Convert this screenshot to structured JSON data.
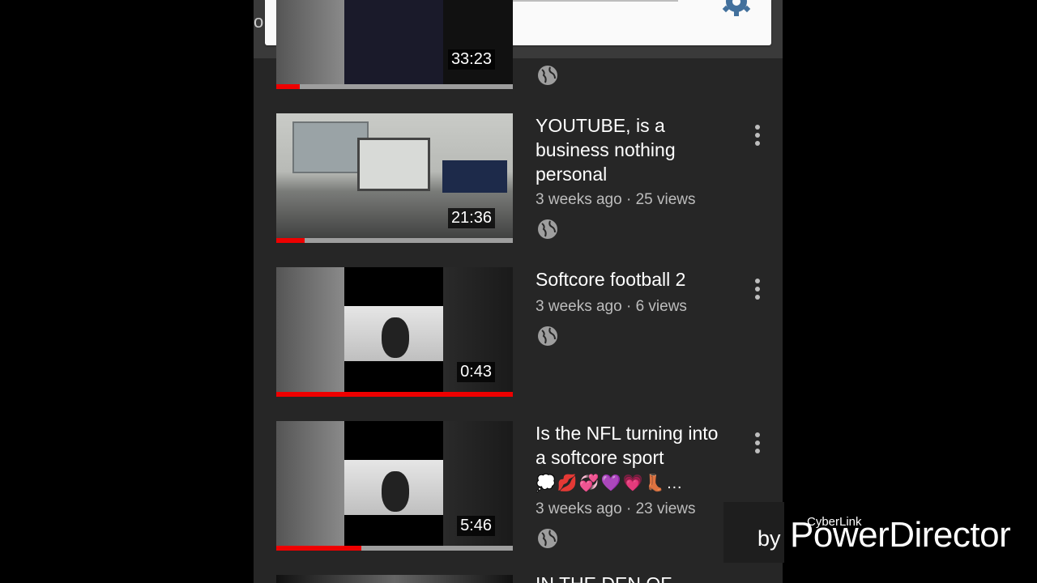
{
  "panel": {
    "edge_letter": "o",
    "music_icon": "music-note-off-icon",
    "settings_icon": "gear-icon"
  },
  "videos": [
    {
      "title": "",
      "duration": "33:23",
      "progress_pct": 10,
      "meta": ""
    },
    {
      "title": "YOUTUBE, is a business nothing personal",
      "duration": "21:36",
      "progress_pct": 12,
      "meta": "3 weeks ago · 25 views"
    },
    {
      "title": "Softcore football 2",
      "duration": "0:43",
      "progress_pct": 100,
      "meta": "3 weeks ago · 6 views"
    },
    {
      "title": "Is the NFL turning into a softcore sport",
      "emoji": "💭💋💞💜💗👢…",
      "duration": "5:46",
      "progress_pct": 36,
      "meta": "3 weeks ago · 23 views"
    }
  ],
  "partial_next_title": "IN THE DEN OF",
  "watermark": {
    "brand_small": "CyberLink",
    "by": "by",
    "product": "PowerDirector"
  },
  "colors": {
    "progress": "#ee0000",
    "seek_thumb": "#4db6ac",
    "background": "#262626"
  }
}
